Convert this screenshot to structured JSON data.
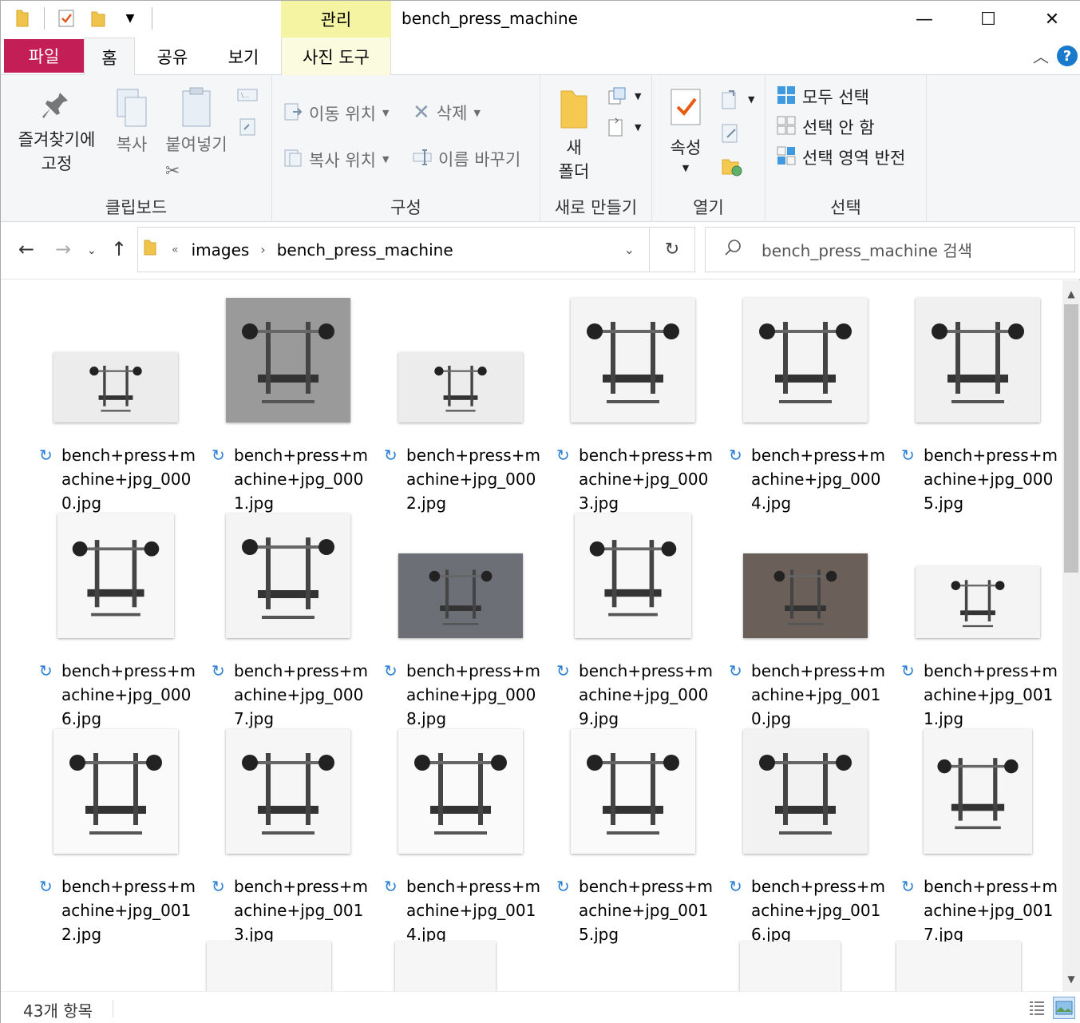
{
  "window": {
    "title": "bench_press_machine",
    "context_tab_header": "관리",
    "controls": {
      "minimize": "—",
      "maximize": "☐",
      "close": "✕"
    }
  },
  "tabs": [
    "파일",
    "홈",
    "공유",
    "보기",
    "사진 도구"
  ],
  "ribbon": {
    "clipboard": {
      "label": "클립보드",
      "pin": "즐겨찾기에\n고정",
      "copy": "복사",
      "paste": "붙여넣기"
    },
    "organize": {
      "label": "구성",
      "move_to": "이동 위치",
      "copy_to": "복사 위치",
      "delete": "삭제",
      "rename": "이름 바꾸기"
    },
    "new": {
      "label": "새로 만들기",
      "new_folder": "새\n폴더"
    },
    "open": {
      "label": "열기",
      "properties": "속성"
    },
    "select": {
      "label": "선택",
      "select_all": "모두 선택",
      "select_none": "선택 안 함",
      "invert": "선택 영역 반전"
    }
  },
  "address": {
    "overflow": "«",
    "crumbs": [
      "images",
      "bench_press_machine"
    ],
    "search_placeholder": "bench_press_machine 검색"
  },
  "files": [
    {
      "name": "bench+press+machine+jpg_0000.jpg"
    },
    {
      "name": "bench+press+machine+jpg_0001.jpg"
    },
    {
      "name": "bench+press+machine+jpg_0002.jpg"
    },
    {
      "name": "bench+press+machine+jpg_0003.jpg"
    },
    {
      "name": "bench+press+machine+jpg_0004.jpg"
    },
    {
      "name": "bench+press+machine+jpg_0005.jpg"
    },
    {
      "name": "bench+press+machine+jpg_0006.jpg"
    },
    {
      "name": "bench+press+machine+jpg_0007.jpg"
    },
    {
      "name": "bench+press+machine+jpg_0008.jpg"
    },
    {
      "name": "bench+press+machine+jpg_0009.jpg"
    },
    {
      "name": "bench+press+machine+jpg_0010.jpg"
    },
    {
      "name": "bench+press+machine+jpg_0011.jpg"
    },
    {
      "name": "bench+press+machine+jpg_0012.jpg"
    },
    {
      "name": "bench+press+machine+jpg_0013.jpg"
    },
    {
      "name": "bench+press+machine+jpg_0014.jpg"
    },
    {
      "name": "bench+press+machine+jpg_0015.jpg"
    },
    {
      "name": "bench+press+machine+jpg_0016.jpg"
    },
    {
      "name": "bench+press+machine+jpg_0017.jpg"
    }
  ],
  "status": {
    "item_count": "43개 항목"
  },
  "colors": {
    "file_tab": "#c41e57",
    "context_tab": "#f5f4a2",
    "accent": "#1979ca"
  }
}
